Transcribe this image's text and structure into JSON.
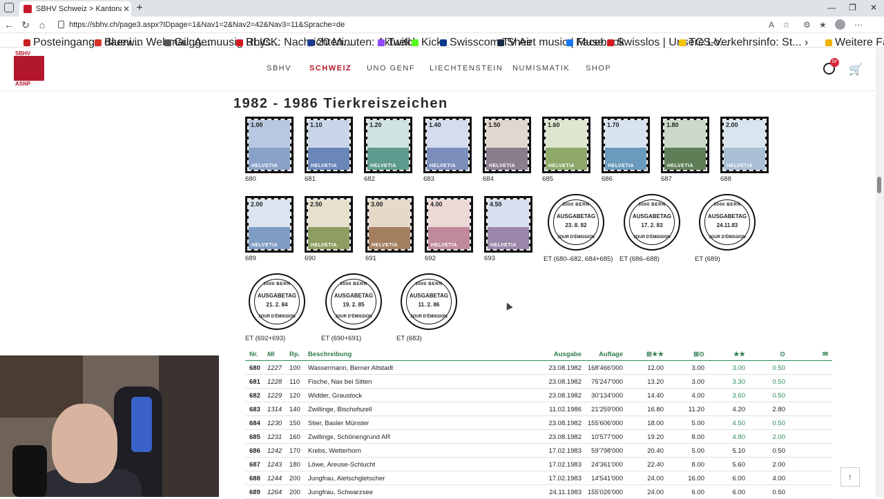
{
  "browser": {
    "tab_title": "SBHV Schweiz > Kantonal- und F",
    "url": "https://sbhv.ch/page3.aspx?IDpage=1&Nav1=2&Nav2=42&Nav3=11&Sprache=de",
    "bookmarks": [
      {
        "label": "Posteingang - daeni...",
        "color": "#c5221f"
      },
      {
        "label": "Bluewin Webmail: A...",
        "color": "#d93025"
      },
      {
        "label": "Guggemuusig Rhys...",
        "color": "#555555"
      },
      {
        "label": "BLICK: Nachrichten...",
        "color": "#d71921"
      },
      {
        "label": "20 Minuten: Aktuell...",
        "color": "#1a3d8f"
      },
      {
        "label": "Twitch",
        "color": "#9146ff"
      },
      {
        "label": "Kick",
        "color": "#53fc18"
      },
      {
        "label": "Swisscom TV Air",
        "color": "#0b3c8c"
      },
      {
        "label": "Sheet music | Muse...",
        "color": "#1b2a47"
      },
      {
        "label": "Facebook",
        "color": "#1877f2"
      },
      {
        "label": "Swisslos | Unsere Lo...",
        "color": "#d71921"
      },
      {
        "label": "TCS-Verkehrsinfo: St...",
        "color": "#f5c400"
      }
    ],
    "favorites_label": "Weitere Favoriten"
  },
  "site": {
    "logo_top": "SBHV",
    "logo_bottom": "ASNP",
    "nav": [
      "SBHV",
      "SCHWEIZ",
      "UNO GENF",
      "LIECHTENSTEIN",
      "NUMISMATIK",
      "SHOP"
    ],
    "badge": "DF",
    "brand_color": "#b3172b"
  },
  "content": {
    "heading": "1982 - 1986 Tierkreiszeichen",
    "stamps": [
      {
        "num": "680",
        "val": "1.00",
        "sky": "#b8c8e0",
        "land": "#8aa2c8"
      },
      {
        "num": "681",
        "val": "1.10",
        "sky": "#c9d6ea",
        "land": "#6b86b8"
      },
      {
        "num": "682",
        "val": "1.20",
        "sky": "#cfe3e0",
        "land": "#5f9a8e"
      },
      {
        "num": "683",
        "val": "1.40",
        "sky": "#d5dcef",
        "land": "#7c8fbc"
      },
      {
        "num": "684",
        "val": "1.50",
        "sky": "#e0d8cf",
        "land": "#8a7d8e"
      },
      {
        "num": "685",
        "val": "1.60",
        "sky": "#dfe6d0",
        "land": "#8ea86a"
      },
      {
        "num": "686",
        "val": "1.70",
        "sky": "#d7e3ef",
        "land": "#6a9abd"
      },
      {
        "num": "687",
        "val": "1.80",
        "sky": "#cbd9c8",
        "land": "#5e7e58"
      },
      {
        "num": "688",
        "val": "2.00",
        "sky": "#d9e6ef",
        "land": "#a8bfd4"
      },
      {
        "num": "689",
        "val": "2.00",
        "sky": "#dbe4f0",
        "land": "#7f9cc4"
      },
      {
        "num": "690",
        "val": "2.50",
        "sky": "#e6e0cc",
        "land": "#8e9e63"
      },
      {
        "num": "691",
        "val": "3.00",
        "sky": "#e5d9c7",
        "land": "#a37f5f"
      },
      {
        "num": "692",
        "val": "4.00",
        "sky": "#ecd8d6",
        "land": "#c08a9c"
      },
      {
        "num": "693",
        "val": "4.50",
        "sky": "#d8dfee",
        "land": "#9a86a8"
      }
    ],
    "postmarks": [
      {
        "date": "23. 8. 82",
        "label": "ET (680–682, 684+685)"
      },
      {
        "date": "17. 2. 83",
        "label": "ET (686–688)"
      },
      {
        "date": "24.11.83",
        "label": "ET (689)"
      },
      {
        "date": "21. 2. 84",
        "label": "ET (692+693)"
      },
      {
        "date": "19. 2. 85",
        "label": "ET (690+691)"
      },
      {
        "date": "11. 2. 86",
        "label": "ET (683)"
      }
    ],
    "postmark_top": "3000 BERN",
    "postmark_text": "AUSGABETAG",
    "postmark_bottom": "JOUR D'ÉMISSION",
    "stamp_word": "HELVETIA"
  },
  "table": {
    "headers": {
      "nr": "Nr.",
      "mi": "Mi",
      "rp": "Rp.",
      "desc": "Beschreibung",
      "aus": "Ausgabe",
      "aufl": "Auflage",
      "v1": "⊞★★",
      "v2": "⊞⊙",
      "v3": "★★",
      "v4": "⊙",
      "v5": "✉"
    },
    "rows": [
      {
        "nr": "680",
        "mi": "1227",
        "rp": "100",
        "desc": "Wassermann, Berner Altstadt",
        "aus": "23.08.1982",
        "aufl": "168'466'000",
        "v1": "12.00",
        "v2": "3.00",
        "v3": "3.00",
        "v4": "0.50"
      },
      {
        "nr": "681",
        "mi": "1228",
        "rp": "110",
        "desc": "Fische, Nax bei Sitten",
        "aus": "23.08.1982",
        "aufl": "75'247'000",
        "v1": "13.20",
        "v2": "3.00",
        "v3": "3.30",
        "v4": "0.50"
      },
      {
        "nr": "682",
        "mi": "1229",
        "rp": "120",
        "desc": "Widder, Graustock",
        "aus": "23.08.1982",
        "aufl": "30'134'000",
        "v1": "14.40",
        "v2": "4.00",
        "v3": "3.60",
        "v4": "0.50"
      },
      {
        "nr": "683",
        "mi": "1314",
        "rp": "140",
        "desc": "Zwillinge, Bischofszell",
        "aus": "11.02.1986",
        "aufl": "21'259'000",
        "v1": "16.80",
        "v2": "11.20",
        "v3": "4.20",
        "v4": "2.80"
      },
      {
        "nr": "684",
        "mi": "1230",
        "rp": "150",
        "desc": "Stier, Basler Münster",
        "aus": "23.08.1982",
        "aufl": "155'606'000",
        "v1": "18.00",
        "v2": "5.00",
        "v3": "4.50",
        "v4": "0.50"
      },
      {
        "nr": "685",
        "mi": "1231",
        "rp": "160",
        "desc": "Zwillinge, Schönengrund AR",
        "aus": "23.08.1982",
        "aufl": "10'577'000",
        "v1": "19.20",
        "v2": "8.00",
        "v3": "4.80",
        "v4": "2.00"
      },
      {
        "nr": "686",
        "mi": "1242",
        "rp": "170",
        "desc": "Krebs, Wetterhorn",
        "aus": "17.02.1983",
        "aufl": "59'798'000",
        "v1": "20.40",
        "v2": "5.00",
        "v3": "5.10",
        "v4": "0.50"
      },
      {
        "nr": "687",
        "mi": "1243",
        "rp": "180",
        "desc": "Löwe, Areuse-Schlucht",
        "aus": "17.02.1983",
        "aufl": "24'361'000",
        "v1": "22.40",
        "v2": "8.00",
        "v3": "5.60",
        "v4": "2.00"
      },
      {
        "nr": "688",
        "mi": "1244",
        "rp": "200",
        "desc": "Jungfrau, Aletschgletscher",
        "aus": "17.02.1983",
        "aufl": "14'541'000",
        "v1": "24.00",
        "v2": "16.00",
        "v3": "6.00",
        "v4": "4.00"
      },
      {
        "nr": "689",
        "mi": "1264",
        "rp": "200",
        "desc": "Jungfrau, Schwarzsee",
        "aus": "24.11.1983",
        "aufl": "155'026'000",
        "v1": "24.00",
        "v2": "6.00",
        "v3": "6.00",
        "v4": "0.50"
      }
    ]
  }
}
